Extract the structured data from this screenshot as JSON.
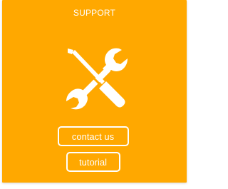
{
  "panel": {
    "title": "SUPPORT",
    "background_color": "#FFA800",
    "text_color": "#FFFFFF",
    "icon": "wrench-screwdriver-icon"
  },
  "buttons": {
    "contact_label": "contact us",
    "tutorial_label": "tutorial"
  }
}
